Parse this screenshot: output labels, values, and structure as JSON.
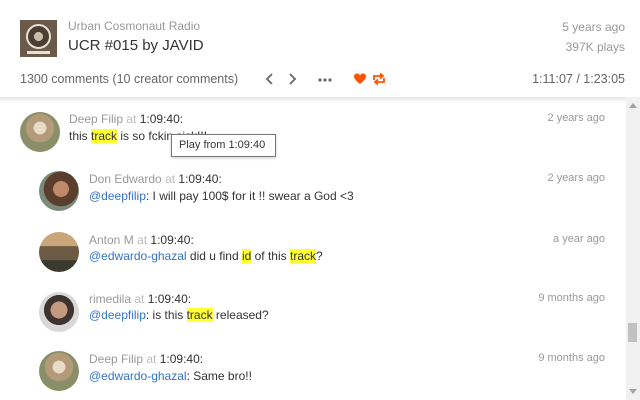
{
  "track": {
    "uploader": "Urban Cosmonaut Radio",
    "title": "UCR #015 by JAVID",
    "age": "5 years ago",
    "plays": "397K plays"
  },
  "toolbar": {
    "comment_count": "1300 comments (10 creator comments)",
    "timecode": "1:11:07 / 1:23:05",
    "icons": [
      "chevron-left-icon",
      "chevron-right-icon",
      "more-icon",
      "heart-icon",
      "repost-icon"
    ],
    "accent_color": "#ff5500"
  },
  "tooltip": "Play from 1:09:40",
  "comments": [
    {
      "user": "Deep Filip",
      "at": "at",
      "time": "1:09:40:",
      "date": "2 years ago",
      "body": [
        {
          "text": "this "
        },
        {
          "text": "track",
          "highlight": true
        },
        {
          "text": " is so fckin sick!!!"
        }
      ]
    },
    {
      "user": "Don Edwardo",
      "at": "at",
      "time": "1:09:40:",
      "date": "2 years ago",
      "body": [
        {
          "text": "@deepfilip",
          "mention": true
        },
        {
          "text": ": I will pay 100$ for it !! swear a God <3"
        }
      ]
    },
    {
      "user": "Anton M",
      "at": "at",
      "time": "1:09:40:",
      "date": "a year ago",
      "body": [
        {
          "text": "@edwardo-ghazal",
          "mention": true
        },
        {
          "text": " did u find "
        },
        {
          "text": "id",
          "highlight": true
        },
        {
          "text": " of this "
        },
        {
          "text": "track",
          "highlight": true
        },
        {
          "text": "?"
        }
      ]
    },
    {
      "user": "rimedila",
      "at": "at",
      "time": "1:09:40:",
      "date": "9 months ago",
      "body": [
        {
          "text": "@deepfilip",
          "mention": true
        },
        {
          "text": ": is this "
        },
        {
          "text": "track",
          "highlight": true
        },
        {
          "text": " released?"
        }
      ]
    },
    {
      "user": "Deep Filip",
      "at": "at",
      "time": "1:09:40:",
      "date": "9 months ago",
      "body": [
        {
          "text": "@edwardo-ghazal",
          "mention": true
        },
        {
          "text": ": Same bro!!"
        }
      ]
    }
  ]
}
